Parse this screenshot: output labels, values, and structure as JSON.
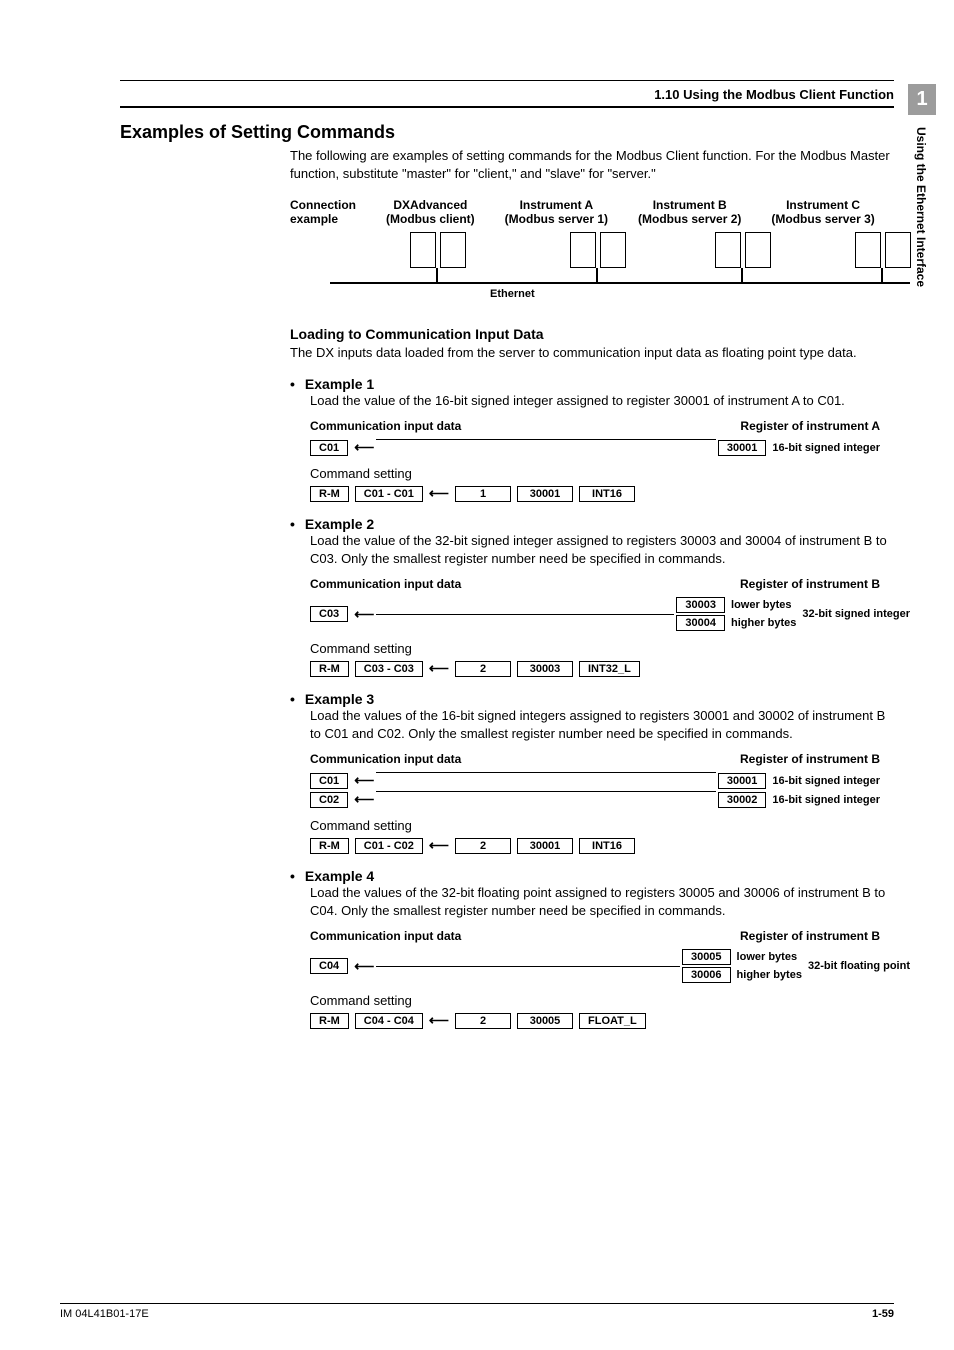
{
  "header": {
    "crumb": "1.10  Using the Modbus Client Function"
  },
  "sidebar": {
    "chapter": "1",
    "title": "Using the Ethernet Interface"
  },
  "title": "Examples of Setting Commands",
  "intro": "The following are examples of setting commands for the Modbus Client function. For the Modbus Master function, substitute \"master\" for \"client,\" and \"slave\" for \"server.\"",
  "conn": {
    "label1": "Connection",
    "label2": "example",
    "cols": [
      {
        "t1": "DXAdvanced",
        "t2": "(Modbus client)"
      },
      {
        "t1": "Instrument A",
        "t2": "(Modbus server 1)"
      },
      {
        "t1": "Instrument B",
        "t2": "(Modbus server 2)"
      },
      {
        "t1": "Instrument C",
        "t2": "(Modbus server 3)"
      }
    ],
    "eth": "Ethernet"
  },
  "load": {
    "h": "Loading to Communication Input Data",
    "p": "The DX inputs data loaded from the server to communication input data as floating point type data."
  },
  "labels": {
    "cid": "Communication input data",
    "cmd": "Command setting",
    "riA": "Register of instrument A",
    "riB": "Register of instrument B"
  },
  "ex1": {
    "h": "Example 1",
    "p": "Load the value of the 16-bit signed integer assigned to register 30001 of instrument A to C01.",
    "cbox": "C01",
    "reg": "30001",
    "regnote": "16-bit signed integer",
    "cmd": {
      "a": "R-M",
      "b": "C01 - C01",
      "c": "1",
      "d": "30001",
      "e": "INT16"
    }
  },
  "ex2": {
    "h": "Example 2",
    "p": "Load the value of the 32-bit signed integer assigned to registers 30003 and 30004 of instrument B to C03. Only the smallest register number need be specified in commands.",
    "cbox": "C03",
    "reg1": "30003",
    "n1": "lower bytes",
    "reg2": "30004",
    "n2": "higher bytes",
    "note": "32-bit signed integer",
    "cmd": {
      "a": "R-M",
      "b": "C03 - C03",
      "c": "2",
      "d": "30003",
      "e": "INT32_L"
    }
  },
  "ex3": {
    "h": "Example 3",
    "p": "Load the values of the 16-bit signed integers assigned to registers 30001 and 30002 of instrument B to C01 and C02. Only the smallest register number need be specified in commands.",
    "c1": "C01",
    "r1": "30001",
    "rn1": "16-bit signed integer",
    "c2": "C02",
    "r2": "30002",
    "rn2": "16-bit signed integer",
    "cmd": {
      "a": "R-M",
      "b": "C01 - C02",
      "c": "2",
      "d": "30001",
      "e": "INT16"
    }
  },
  "ex4": {
    "h": "Example 4",
    "p": "Load the values of the 32-bit floating point assigned to registers 30005 and 30006 of instrument B to C04. Only the smallest register number need be specified in commands.",
    "cbox": "C04",
    "reg1": "30005",
    "n1": "lower bytes",
    "reg2": "30006",
    "n2": "higher bytes",
    "note": "32-bit floating point",
    "cmd": {
      "a": "R-M",
      "b": "C04 - C04",
      "c": "2",
      "d": "30005",
      "e": "FLOAT_L"
    }
  },
  "footer": {
    "left": "IM 04L41B01-17E",
    "right": "1-59"
  }
}
